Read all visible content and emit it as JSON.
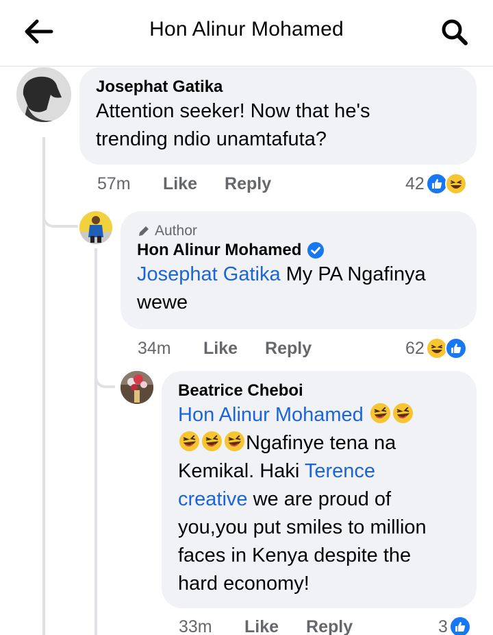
{
  "header": {
    "title": "Hon Alinur Mohamed",
    "back_icon": "arrow-left-icon",
    "search_icon": "search-icon"
  },
  "comments": [
    {
      "author": "Josephat Gatika",
      "text_lines": [
        "Attention seeker!  Now that he's",
        "trending ndio unamtafuta?"
      ],
      "time": "57m",
      "like": "Like",
      "reply": "Reply",
      "reaction_count": "42",
      "reactions": [
        "like-icon",
        "haha-icon"
      ]
    },
    {
      "author_badge": "Author",
      "author": "Hon Alinur Mohamed",
      "verified_icon": "verified-badge-icon",
      "mention": "Josephat Gatika",
      "text_after_mention": " My PA Ngafinya",
      "text_line2": "wewe",
      "time": "34m",
      "like": "Like",
      "reply": "Reply",
      "reaction_count": "62",
      "reactions": [
        "haha-icon",
        "like-icon"
      ]
    },
    {
      "author": "Beatrice Cheboi",
      "mention1": "Hon Alinur Mohamed",
      "emoji_icon": "rolling-laughing-emoji",
      "text_after_emojis": "Ngafinye tena na",
      "text_line3_prefix": "Kemikal. Haki ",
      "mention2_line3": "Terence",
      "mention2_line4": "creative",
      "text_line4_suffix": " we are proud of",
      "text_line5": "you,you put smiles to million",
      "text_line6": "faces in Kenya despite the",
      "text_line7": "hard economy!",
      "time": "33m",
      "like": "Like",
      "reply": "Reply",
      "reaction_count": "3",
      "reactions": [
        "like-icon"
      ]
    }
  ],
  "colors": {
    "mention": "#1b64d9",
    "bubble": "#f0f2f5",
    "meta": "#65676b",
    "like_blue": "#1877f2",
    "haha_yellow": "#f7c531"
  }
}
